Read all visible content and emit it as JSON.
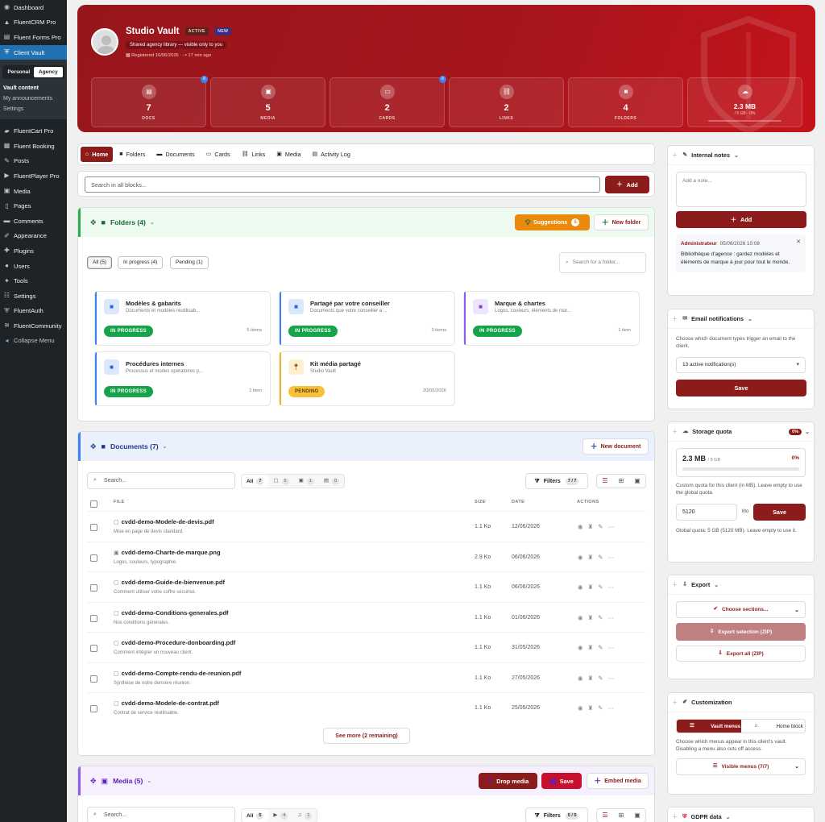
{
  "sidebar": {
    "items_top": [
      {
        "label": "Dashboard",
        "icon": "dashboard-icon"
      },
      {
        "label": "FluentCRM Pro",
        "icon": "crm-icon"
      },
      {
        "label": "Fluent Forms Pro",
        "icon": "forms-icon"
      },
      {
        "label": "Client Vault",
        "icon": "vault-icon"
      }
    ],
    "context_toggle": [
      "Personal",
      "Agency"
    ],
    "submenu": [
      "Vault content",
      "My announcements",
      "Settings"
    ],
    "items_bottom": [
      {
        "label": "FluentCart Pro",
        "icon": "cart-icon"
      },
      {
        "label": "Fluent Booking",
        "icon": "calendar-icon"
      },
      {
        "label": "Posts",
        "icon": "pin-icon"
      },
      {
        "label": "FluentPlayer Pro",
        "icon": "play-icon"
      },
      {
        "label": "Media",
        "icon": "media-icon"
      },
      {
        "label": "Pages",
        "icon": "pages-icon"
      },
      {
        "label": "Comments",
        "icon": "comment-icon"
      },
      {
        "label": "Appearance",
        "icon": "brush-icon"
      },
      {
        "label": "Plugins",
        "icon": "plugin-icon"
      },
      {
        "label": "Users",
        "icon": "user-icon"
      },
      {
        "label": "Tools",
        "icon": "wrench-icon"
      },
      {
        "label": "Settings",
        "icon": "settings-icon"
      },
      {
        "label": "FluentAuth",
        "icon": "shield-icon"
      },
      {
        "label": "FluentCommunity",
        "icon": "community-icon"
      },
      {
        "label": "Collapse Menu",
        "icon": "collapse-icon"
      }
    ]
  },
  "hero": {
    "title": "Studio Vault",
    "badge_active": "ACTIVE",
    "badge_new": "NEW",
    "subtitle": "Shared agency library — visible only to you",
    "registered": "Registered 16/06/2026",
    "ago": "17 min ago",
    "stats": [
      {
        "value": "7",
        "label": "DOCS",
        "icon": "doc-icon",
        "dot": "8"
      },
      {
        "value": "5",
        "label": "MEDIA",
        "icon": "media-icon",
        "dot": ""
      },
      {
        "value": "2",
        "label": "CARDS",
        "icon": "cards-icon",
        "dot": "8"
      },
      {
        "value": "2",
        "label": "LINKS",
        "icon": "link-icon",
        "dot": ""
      },
      {
        "value": "4",
        "label": "FOLDERS",
        "icon": "folder-icon",
        "dot": ""
      }
    ],
    "storage": {
      "value": "2.3 MB",
      "sub": "/ 5 GB · 0%",
      "icon": "cloud-icon",
      "fraction": 0.0
    }
  },
  "tabs": [
    {
      "label": "Home",
      "icon": "home-icon"
    },
    {
      "label": "Folders",
      "icon": "folder-icon"
    },
    {
      "label": "Documents",
      "icon": "documents-icon"
    },
    {
      "label": "Cards",
      "icon": "cards-icon"
    },
    {
      "label": "Links",
      "icon": "link-icon"
    },
    {
      "label": "Media",
      "icon": "media-icon"
    },
    {
      "label": "Activity Log",
      "icon": "log-icon"
    }
  ],
  "search": {
    "placeholder": "Search in all blocks...",
    "add": "Add"
  },
  "folders": {
    "title": "Folders (4)",
    "suggestions": "Suggestions",
    "suggestions_count": "5",
    "new_folder": "New folder",
    "filters": [
      "All (5)",
      "In progress (4)",
      "Pending (1)"
    ],
    "search_placeholder": "Search for a folder...",
    "cards": [
      {
        "name": "Modèles & gabarits",
        "desc": "Documents et modèles réutilisab...",
        "status": "IN PROGRESS",
        "count": "5 items",
        "accent": "#3b82f6"
      },
      {
        "name": "Partagé par votre conseiller",
        "desc": "Documents que votre conseiller a ...",
        "status": "IN PROGRESS",
        "count": "3 items",
        "accent": "#3b82f6"
      },
      {
        "name": "Marque & chartes",
        "desc": "Logos, couleurs, éléments de mar...",
        "status": "IN PROGRESS",
        "count": "1 item",
        "accent": "#8b5cf6"
      },
      {
        "name": "Procédures internes",
        "desc": "Processus et modes opératoires p...",
        "status": "IN PROGRESS",
        "count": "1 item",
        "accent": "#3b82f6"
      },
      {
        "name": "Kit média partagé",
        "desc": "Studio Vault",
        "status": "PENDING",
        "count": "20/05/2026",
        "accent": "#f0b429"
      }
    ]
  },
  "documents": {
    "title": "Documents (7)",
    "new_document": "New document",
    "search_placeholder": "Search...",
    "type_filter": [
      {
        "label": "All",
        "count": "7"
      },
      {
        "label": "",
        "count": "5",
        "icon": "file-icon"
      },
      {
        "label": "",
        "count": "1",
        "icon": "image-icon"
      },
      {
        "label": "",
        "count": "0",
        "icon": "doc-icon"
      }
    ],
    "filters_label": "Filters",
    "filters_count": "7 / 7",
    "columns": [
      "FILE",
      "SIZE",
      "DATE",
      "ACTIONS"
    ],
    "rows": [
      {
        "name": "cvdd-demo-Modele-de-devis.pdf",
        "desc": "Mise en page de devis standard.",
        "size": "1.1 Ko",
        "date": "12/06/2026"
      },
      {
        "name": "cvdd-demo-Charte-de-marque.png",
        "desc": "Logos, couleurs, typographie.",
        "size": "2.9 Ko",
        "date": "06/06/2026"
      },
      {
        "name": "cvdd-demo-Guide-de-bienvenue.pdf",
        "desc": "Comment utiliser votre coffre sécurisé.",
        "size": "1.1 Ko",
        "date": "06/06/2026"
      },
      {
        "name": "cvdd-demo-Conditions-generales.pdf",
        "desc": "Nos conditions générales.",
        "size": "1.1 Ko",
        "date": "01/06/2026"
      },
      {
        "name": "cvdd-demo-Procedure-donboarding.pdf",
        "desc": "Comment intégrer un nouveau client.",
        "size": "1.1 Ko",
        "date": "31/05/2026"
      },
      {
        "name": "cvdd-demo-Compte-rendu-de-reunion.pdf",
        "desc": "Synthèse de notre dernière réunion.",
        "size": "1.1 Ko",
        "date": "27/05/2026"
      },
      {
        "name": "cvdd-demo-Modele-de-contrat.pdf",
        "desc": "Contrat de service réutilisable.",
        "size": "1.1 Ko",
        "date": "25/05/2026"
      }
    ],
    "see_more": "See more (2 remaining)"
  },
  "media": {
    "title": "Media (5)",
    "drop": "Drop media",
    "save": "Save",
    "embed": "Embed media",
    "search_placeholder": "Search...",
    "type_filter": [
      {
        "label": "All",
        "count": "5"
      },
      {
        "label": "",
        "count": "4",
        "icon": "video-icon"
      },
      {
        "label": "",
        "count": "1",
        "icon": "music-icon"
      }
    ],
    "filters_label": "Filters",
    "filters_count": "5 / 5"
  },
  "right": {
    "notes": {
      "title": "Internal notes",
      "placeholder": "Add a note...",
      "add": "Add",
      "note_author": "Administrateur",
      "note_date": "05/06/2026 10:08",
      "note_text": "Bibliothèque d'agence : gardez modèles et éléments de marque à jour pour tout le monde."
    },
    "email": {
      "title": "Email notifications",
      "desc": "Choose which document types trigger an email to the client.",
      "select": "13 active notification(s)",
      "save": "Save"
    },
    "storage": {
      "title": "Storage quota",
      "badge": "0%",
      "value": "2.3 MB",
      "total": "/ 5 GB",
      "percent": "0%",
      "desc": "Custom quota for this client (in MB). Leave empty to use the global quota.",
      "input": "5120",
      "unit": "Mo",
      "save": "Save",
      "global": "Global quota: 5 GB (5120 MB). Leave empty to use it."
    },
    "export": {
      "title": "Export",
      "choose": "Choose sections...",
      "selection": "Export selection (ZIP)",
      "all": "Export all (ZIP)"
    },
    "customization": {
      "title": "Customization",
      "seg_vault": "Vault menus",
      "seg_home": "Home block",
      "desc": "Choose which menus appear in this client's vault. Disabling a menu also cuts off access.",
      "visible": "Visible menus (7/7)"
    },
    "gdpr": {
      "title": "GDPR data"
    }
  }
}
